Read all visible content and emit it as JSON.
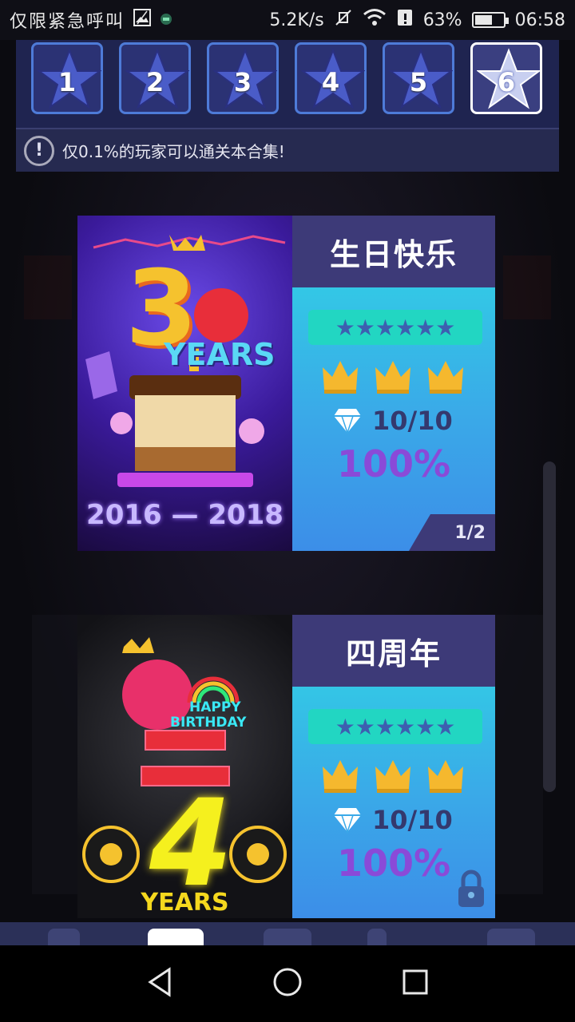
{
  "status_bar": {
    "carrier": "仅限紧急呼叫",
    "net_speed": "5.2K/s",
    "battery": "63%",
    "battery_level": 0.63,
    "time": "06:58"
  },
  "levels": {
    "buttons": [
      "1",
      "2",
      "3",
      "4",
      "5",
      "6"
    ],
    "selected_index": 5
  },
  "notice": {
    "icon": "exclamation-circle-icon",
    "text": "仅0.1%的玩家可以通关本合集!"
  },
  "cards": [
    {
      "title": "生日快乐",
      "art_years_label": "YEARS",
      "art_number": "3",
      "art_dates": "2016 — 2018",
      "stars": "★★★★★★",
      "crowns": 3,
      "diamonds": "10/10",
      "percent": "100%",
      "pager": "1/2",
      "locked": false
    },
    {
      "title": "四周年",
      "art_number": "4",
      "art_years_label": "YEARS",
      "art_banner_1": "HAPPY",
      "art_banner_2": "BIRTHDAY",
      "stars": "★★★★★★",
      "crowns": 3,
      "diamonds": "10/10",
      "percent": "100%",
      "locked": true
    }
  ],
  "colors": {
    "panel_blue": "#1f2450",
    "title_purple": "#3d3a78",
    "percent_purple": "#8a4ad8",
    "crown_gold": "#f5b82e"
  }
}
